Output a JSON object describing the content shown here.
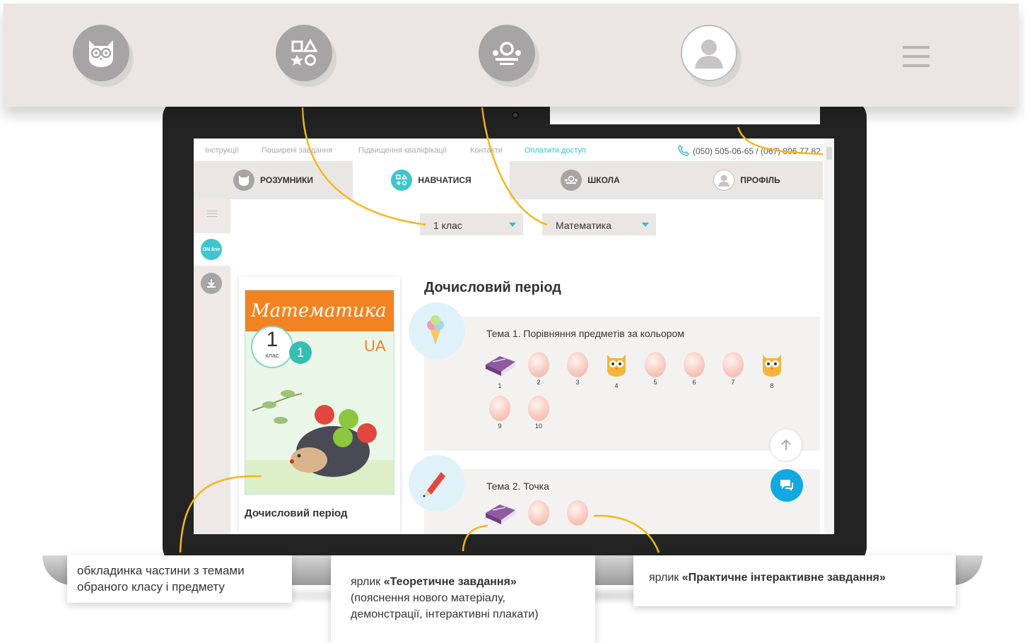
{
  "top_nav": {
    "icons": [
      "owl-icon",
      "shapes-icon",
      "school-icon",
      "profile-icon",
      "menu-icon"
    ]
  },
  "site": {
    "util_links": [
      "Інструкції",
      "Поширені завдання",
      "Підвищення кваліфікації",
      "Контакти"
    ],
    "pay_link": "Оплатити доступ",
    "phone": "(050) 505-06-65 / (067) 806 77 82",
    "tabs": [
      {
        "label": "РОЗУМНИКИ",
        "icon": "owl-icon"
      },
      {
        "label": "НАВЧАТИСЯ",
        "icon": "shapes-icon"
      },
      {
        "label": "ШКОЛА",
        "icon": "school-icon"
      },
      {
        "label": "ПРОФІЛЬ",
        "icon": "profile-icon"
      }
    ],
    "sidebar": {
      "online_badge": "ON line",
      "download_icon": "download-icon"
    },
    "filters": {
      "grade": "1 клас",
      "subject": "Математика"
    },
    "cover": {
      "band_title": "Математика",
      "grade_number": "1",
      "grade_word": "клас",
      "part_number": "1",
      "lang": "UA",
      "caption": "Дочисловий період"
    },
    "section_title": "Дочисловий період",
    "topics": [
      {
        "title": "Тема 1. Порівняння предметів за кольором",
        "tasks": [
          {
            "type": "book",
            "num": "1"
          },
          {
            "type": "egg",
            "num": "2"
          },
          {
            "type": "egg",
            "num": "3"
          },
          {
            "type": "owl",
            "num": "4"
          },
          {
            "type": "egg",
            "num": "5"
          },
          {
            "type": "egg",
            "num": "6"
          },
          {
            "type": "egg",
            "num": "7"
          },
          {
            "type": "owl",
            "num": "8"
          },
          {
            "type": "egg",
            "num": "9"
          },
          {
            "type": "egg",
            "num": "10"
          }
        ]
      },
      {
        "title": "Тема 2. Точка",
        "tasks": [
          {
            "type": "book",
            "num": ""
          },
          {
            "type": "egg",
            "num": ""
          },
          {
            "type": "egg",
            "num": ""
          }
        ]
      }
    ]
  },
  "callouts": {
    "cover": "обкладинка частини з темами обраного класу і предмету",
    "theory_prefix": "ярлик ",
    "theory_bold": "«Теоретичне завдання»",
    "theory_rest": "(пояснення нового матеріалу, демонстрації, інтерактивні плакати)",
    "practice_prefix": "ярлик ",
    "practice_bold": "«Практичне інтерактивне завдання»"
  },
  "colors": {
    "accent_teal": "#3ec6cf",
    "callout_line": "#f4b719",
    "cover_orange": "#f28322",
    "chat_blue": "#12a9e2"
  }
}
